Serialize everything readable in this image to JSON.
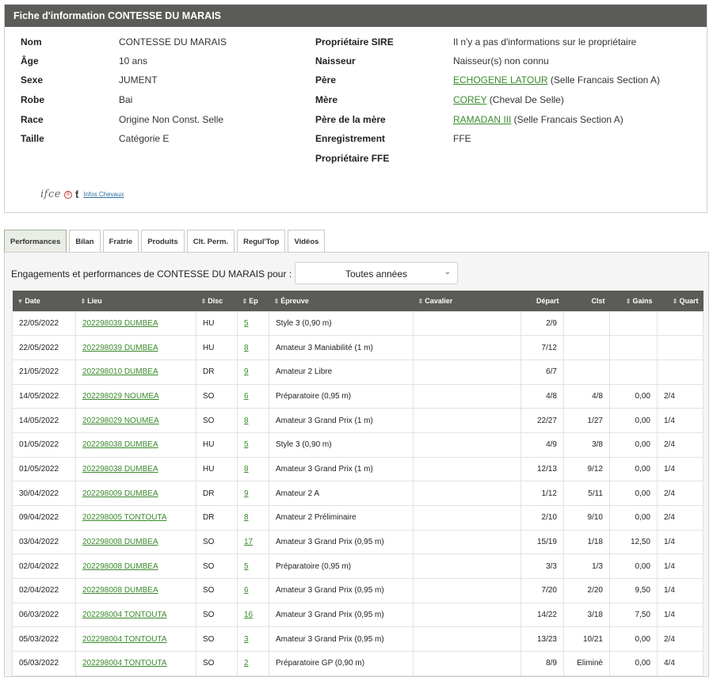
{
  "card": {
    "title": "Fiche d'information CONTESSE DU MARAIS",
    "left": [
      {
        "label": "Nom",
        "value": "CONTESSE DU MARAIS"
      },
      {
        "label": "Âge",
        "value": "10 ans"
      },
      {
        "label": "Sexe",
        "value": "JUMENT"
      },
      {
        "label": "Robe",
        "value": "Bai"
      },
      {
        "label": "Race",
        "value": "Origine Non Const. Selle"
      },
      {
        "label": "Taille",
        "value": "Catégorie E"
      }
    ],
    "right": [
      {
        "label": "Propriétaire SIRE",
        "value": "Il n'y a pas d'informations sur le propriétaire",
        "link": ""
      },
      {
        "label": "Naisseur",
        "value": "Naisseur(s) non connu",
        "link": ""
      },
      {
        "label": "Père",
        "link": "ECHOGENE LATOUR",
        "value": " (Selle Francais Section A)"
      },
      {
        "label": "Mère",
        "link": "COREY",
        "value": " (Cheval De Selle)"
      },
      {
        "label": "Père de la mère",
        "link": "RAMADAN III",
        "value": " (Selle Francais Section A)"
      },
      {
        "label": "Enregistrement",
        "value": "FFE",
        "link": ""
      },
      {
        "label": "Propriétaire FFE",
        "value": "",
        "link": ""
      }
    ],
    "logo": {
      "text": "ifce",
      "link_label": "Infos Chevaux"
    }
  },
  "tabs": [
    "Performances",
    "Bilan",
    "Fratrie",
    "Produits",
    "Clt. Perm.",
    "Regul'Top",
    "Vidéos"
  ],
  "filter": {
    "label": "Engagements et performances de CONTESSE DU MARAIS pour :",
    "selected": "Toutes années"
  },
  "columns": [
    "Date",
    "Lieu",
    "Disc",
    "Ep",
    "Épreuve",
    "Cavalier",
    "Départ",
    "Clst",
    "Gains",
    "Quart"
  ],
  "rows": [
    {
      "date": "22/05/2022",
      "lieu": "202298039 DUMBEA",
      "disc": "HU",
      "ep": "5",
      "epreuve": "Style 3 (0,90 m)",
      "cavalier": "",
      "depart": "2/9",
      "clst": "",
      "gains": "",
      "quart": ""
    },
    {
      "date": "22/05/2022",
      "lieu": "202298039 DUMBEA",
      "disc": "HU",
      "ep": "8",
      "epreuve": "Amateur 3 Maniabilité (1 m)",
      "cavalier": "",
      "depart": "7/12",
      "clst": "",
      "gains": "",
      "quart": ""
    },
    {
      "date": "21/05/2022",
      "lieu": "202298010 DUMBEA",
      "disc": "DR",
      "ep": "9",
      "epreuve": "Amateur 2 Libre",
      "cavalier": "",
      "depart": "6/7",
      "clst": "",
      "gains": "",
      "quart": ""
    },
    {
      "date": "14/05/2022",
      "lieu": "202298029 NOUMEA",
      "disc": "SO",
      "ep": "6",
      "epreuve": "Préparatoire (0,95 m)",
      "cavalier": "",
      "depart": "4/8",
      "clst": "4/8",
      "gains": "0,00",
      "quart": "2/4"
    },
    {
      "date": "14/05/2022",
      "lieu": "202298029 NOUMEA",
      "disc": "SO",
      "ep": "8",
      "epreuve": "Amateur 3 Grand Prix (1 m)",
      "cavalier": "",
      "depart": "22/27",
      "clst": "1/27",
      "gains": "0,00",
      "quart": "1/4"
    },
    {
      "date": "01/05/2022",
      "lieu": "202298038 DUMBEA",
      "disc": "HU",
      "ep": "5",
      "epreuve": "Style 3 (0,90 m)",
      "cavalier": "",
      "depart": "4/9",
      "clst": "3/8",
      "gains": "0,00",
      "quart": "2/4"
    },
    {
      "date": "01/05/2022",
      "lieu": "202298038 DUMBEA",
      "disc": "HU",
      "ep": "8",
      "epreuve": "Amateur 3 Grand Prix (1 m)",
      "cavalier": "",
      "depart": "12/13",
      "clst": "9/12",
      "gains": "0,00",
      "quart": "1/4"
    },
    {
      "date": "30/04/2022",
      "lieu": "202298009 DUMBEA",
      "disc": "DR",
      "ep": "9",
      "epreuve": "Amateur 2 A",
      "cavalier": "",
      "depart": "1/12",
      "clst": "5/11",
      "gains": "0,00",
      "quart": "2/4"
    },
    {
      "date": "09/04/2022",
      "lieu": "202298005 TONTOUTA",
      "disc": "DR",
      "ep": "8",
      "epreuve": "Amateur 2 Préliminaire",
      "cavalier": "",
      "depart": "2/10",
      "clst": "9/10",
      "gains": "0,00",
      "quart": "2/4"
    },
    {
      "date": "03/04/2022",
      "lieu": "202298008 DUMBEA",
      "disc": "SO",
      "ep": "17",
      "epreuve": "Amateur 3 Grand Prix (0,95 m)",
      "cavalier": "",
      "depart": "15/19",
      "clst": "1/18",
      "gains": "12,50",
      "quart": "1/4"
    },
    {
      "date": "02/04/2022",
      "lieu": "202298008 DUMBEA",
      "disc": "SO",
      "ep": "5",
      "epreuve": "Préparatoire (0,95 m)",
      "cavalier": "",
      "depart": "3/3",
      "clst": "1/3",
      "gains": "0,00",
      "quart": "1/4"
    },
    {
      "date": "02/04/2022",
      "lieu": "202298008 DUMBEA",
      "disc": "SO",
      "ep": "6",
      "epreuve": "Amateur 3 Grand Prix (0,95 m)",
      "cavalier": "",
      "depart": "7/20",
      "clst": "2/20",
      "gains": "9,50",
      "quart": "1/4"
    },
    {
      "date": "06/03/2022",
      "lieu": "202298004 TONTOUTA",
      "disc": "SO",
      "ep": "16",
      "epreuve": "Amateur 3 Grand Prix (0,95 m)",
      "cavalier": "",
      "depart": "14/22",
      "clst": "3/18",
      "gains": "7,50",
      "quart": "1/4"
    },
    {
      "date": "05/03/2022",
      "lieu": "202298004 TONTOUTA",
      "disc": "SO",
      "ep": "3",
      "epreuve": "Amateur 3 Grand Prix (0,95 m)",
      "cavalier": "",
      "depart": "13/23",
      "clst": "10/21",
      "gains": "0,00",
      "quart": "2/4"
    },
    {
      "date": "05/03/2022",
      "lieu": "202298004 TONTOUTA",
      "disc": "SO",
      "ep": "2",
      "epreuve": "Préparatoire GP (0,90 m)",
      "cavalier": "",
      "depart": "8/9",
      "clst": "Eliminé",
      "gains": "0,00",
      "quart": "4/4"
    }
  ]
}
